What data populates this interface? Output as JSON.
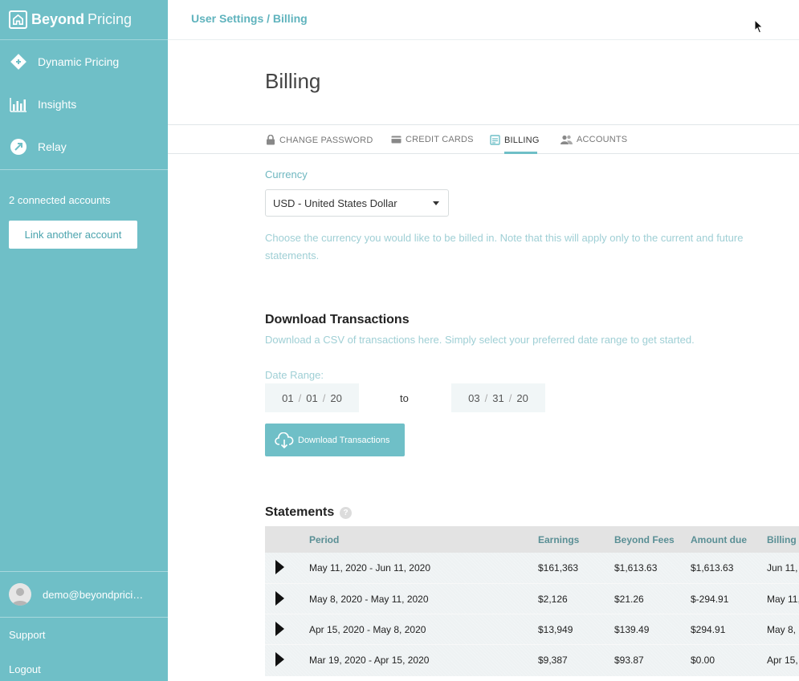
{
  "sidebar": {
    "brand_bold": "Beyond",
    "brand_light": "Pricing",
    "nav": [
      {
        "label": "Dynamic Pricing",
        "icon": "diamond-arrows-icon"
      },
      {
        "label": "Insights",
        "icon": "bar-chart-icon"
      },
      {
        "label": "Relay",
        "icon": "relay-icon"
      }
    ],
    "connected_text": "2 connected accounts",
    "link_button": "Link another account",
    "user_email": "demo@beyondprici…",
    "support": "Support",
    "logout": "Logout"
  },
  "header": {
    "breadcrumb": "User Settings / Billing"
  },
  "page": {
    "title": "Billing"
  },
  "tabs": [
    {
      "label": "CHANGE PASSWORD",
      "icon": "lock-icon"
    },
    {
      "label": "CREDIT CARDS",
      "icon": "credit-card-icon"
    },
    {
      "label": "BILLING",
      "icon": "invoice-icon",
      "active": true
    },
    {
      "label": "ACCOUNTS",
      "icon": "users-icon"
    }
  ],
  "currency": {
    "label": "Currency",
    "selected": "USD - United States Dollar",
    "help": "Choose the currency you would like to be billed in. Note that this will apply only to the current and future statements."
  },
  "download": {
    "title": "Download Transactions",
    "description": "Download a CSV of transactions here. Simply select your preferred date range to get started.",
    "date_range_label": "Date Range:",
    "from": {
      "mm": "01",
      "dd": "01",
      "yy": "20"
    },
    "to_label": "to",
    "to": {
      "mm": "03",
      "dd": "31",
      "yy": "20"
    },
    "button": "Download Transactions"
  },
  "statements": {
    "title": "Statements",
    "help": "?",
    "columns": [
      "Period",
      "Earnings",
      "Beyond Fees",
      "Amount due",
      "Billing"
    ],
    "rows": [
      [
        "May 11, 2020 - Jun 11, 2020",
        "$161,363",
        "$1,613.63",
        "$1,613.63",
        "Jun 11,"
      ],
      [
        "May 8, 2020 - May 11, 2020",
        "$2,126",
        "$21.26",
        "$-294.91",
        "May 11,"
      ],
      [
        "Apr 15, 2020 - May 8, 2020",
        "$13,949",
        "$139.49",
        "$294.91",
        "May 8,"
      ],
      [
        "Mar 19, 2020 - Apr 15, 2020",
        "$9,387",
        "$93.87",
        "$0.00",
        "Apr 15,"
      ]
    ]
  },
  "colors": {
    "sidebar": "#6fbfc7",
    "accent": "#5fb3bd",
    "muted_text": "#9fcfd5"
  }
}
